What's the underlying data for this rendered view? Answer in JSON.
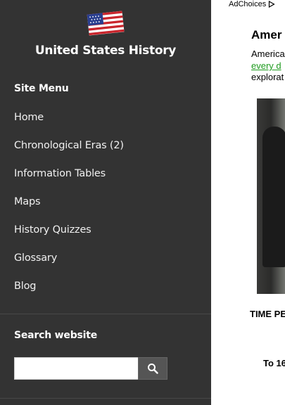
{
  "site": {
    "title": "United States History"
  },
  "sidebar": {
    "menu_heading": "Site Menu",
    "items": [
      {
        "label": "Home"
      },
      {
        "label": "Chronological Eras (2)"
      },
      {
        "label": "Information Tables"
      },
      {
        "label": "Maps"
      },
      {
        "label": "History Quizzes"
      },
      {
        "label": "Glossary"
      },
      {
        "label": "Blog"
      }
    ],
    "search_heading": "Search website",
    "search_placeholder": "",
    "search_icon": "search-icon"
  },
  "main": {
    "adchoices_label": "AdChoices",
    "article_title": "Amer",
    "intro_line1": "America",
    "intro_link": "every d",
    "intro_line3": "explorat",
    "time_period_label": "TIME PE",
    "to_date_label": "To 16"
  },
  "colors": {
    "sidebar_bg": "#333333",
    "link_green": "#1e9b1e"
  }
}
